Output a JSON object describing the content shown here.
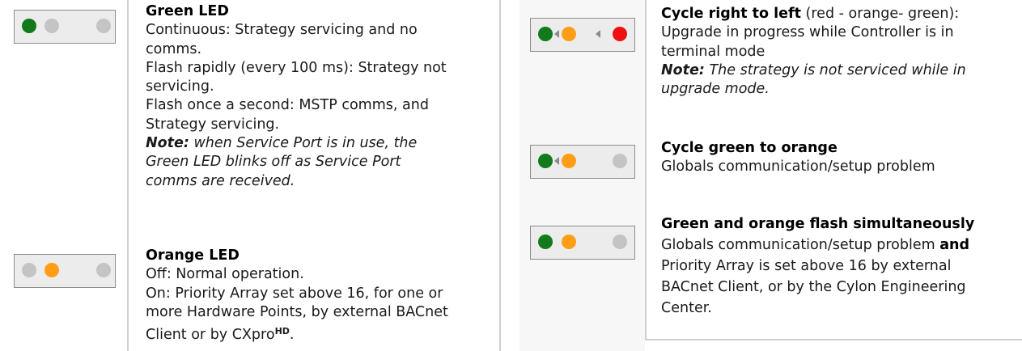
{
  "left": {
    "green": {
      "title": "Green LED",
      "lines": [
        "Continuous: Strategy servicing and no",
        "comms.",
        "Flash rapidly (every 100 ms):  Strategy not",
        "servicing.",
        "Flash once a second:  MSTP comms, and",
        "Strategy servicing."
      ],
      "note_label": "Note:",
      "note_lines": [
        " when Service Port is in use, the",
        "Green LED blinks off as Service Port",
        "comms are received."
      ]
    },
    "orange": {
      "title": "Orange LED",
      "lines": [
        "Off: Normal operation.",
        "On: Priority Array set above 16, for one or",
        "more Hardware Points, by external BACnet"
      ],
      "last_line_prefix": "Client or by CXpro",
      "last_line_sup": "HD",
      "last_line_suffix": "."
    }
  },
  "right": {
    "cycle_rl": {
      "title": "Cycle right to left",
      "title_suffix": " (red - orange- green):",
      "lines": [
        "Upgrade in progress while Controller is in",
        "terminal mode"
      ],
      "note_label": "Note:",
      "note_lines": [
        " The strategy is not serviced while in",
        "upgrade mode."
      ]
    },
    "cycle_go": {
      "title": "Cycle green to orange",
      "lines": [
        "Globals communication/setup problem"
      ]
    },
    "simul": {
      "title": "Green and orange flash simultaneously",
      "line1_prefix": "Globals communication/setup problem ",
      "line1_bold": "and",
      "lines": [
        "Priority Array is set above 16 by external",
        "BACnet Client, or by the Cylon Engineering",
        "Center."
      ]
    }
  },
  "colors": {
    "led_green": "#127a1a",
    "led_orange": "#ff9e16",
    "led_red": "#ef0f0f",
    "led_off": "#c4c4c4"
  }
}
